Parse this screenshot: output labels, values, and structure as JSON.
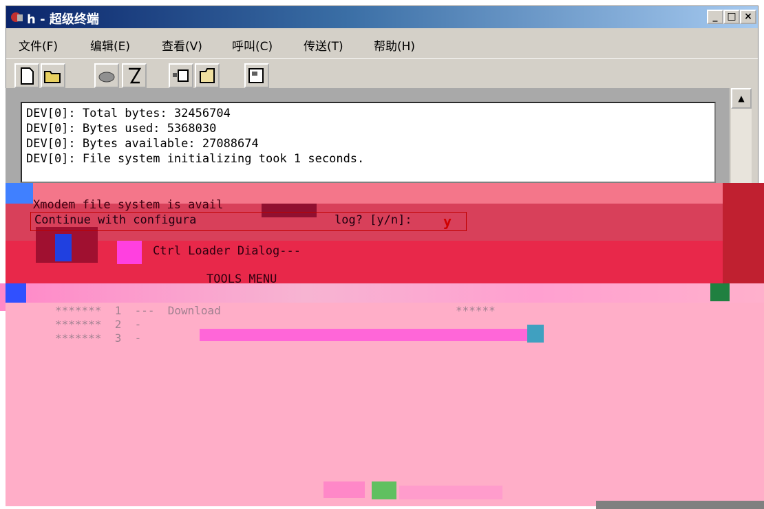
{
  "window": {
    "title": "h - 超级终端",
    "minimize": "_",
    "maximize": "□",
    "close": "×"
  },
  "menubar": {
    "items": [
      "文件(F)",
      "编辑(E)",
      "查看(V)",
      "呼叫(C)",
      "传送(T)",
      "帮助(H)"
    ]
  },
  "toolbar": {
    "buttons": [
      "new-icon",
      "open-icon",
      "disconnect-icon",
      "hangup-icon",
      "send-icon",
      "receive-icon",
      "properties-icon"
    ]
  },
  "terminal": {
    "lines": [
      "DEV[0]: Total bytes: 32456704",
      "DEV[0]: Bytes used: 5368030",
      "DEV[0]: Bytes available: 27088674",
      "DEV[0]: File system initializing took 1 seconds."
    ],
    "xmodem_line": "Xmodem file system is avail",
    "prompt": "Continue with configura",
    "prompt_tail": "log? [y/n]:",
    "answer": "y",
    "dialog_title": "Ctrl Loader Dialog---",
    "tools_menu": "TOOLS MENU",
    "menu_items": [
      "*******  1  ---  Download",
      "*******  2  -",
      "*******  3  -"
    ],
    "menu_stars": "******"
  },
  "colors": {
    "title_start": "#0a246a",
    "title_end": "#a6caf0",
    "glitch_red": "#e8284a",
    "glitch_pink": "#ffaec8",
    "answer_red": "#d00000"
  }
}
